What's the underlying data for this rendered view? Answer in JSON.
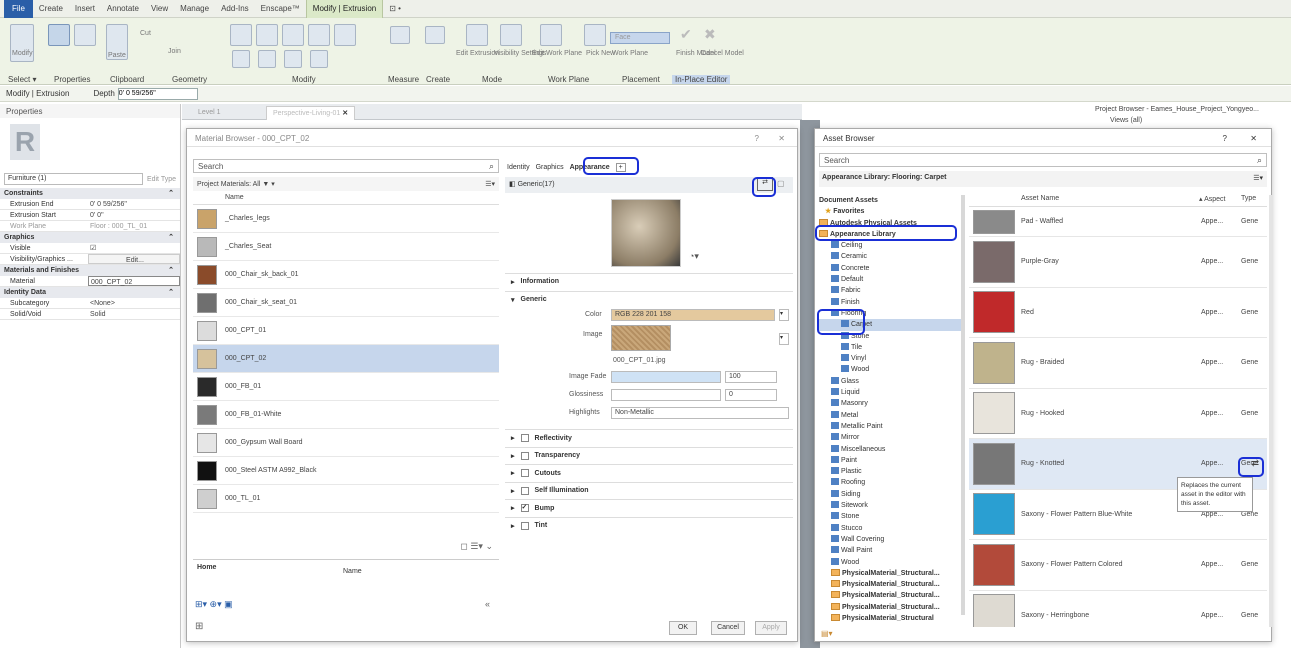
{
  "menu": [
    "File",
    "Create",
    "Insert",
    "Annotate",
    "View",
    "Manage",
    "Add-Ins",
    "Enscape™",
    "Modify | Extrusion",
    "⊡ •"
  ],
  "ribbon": {
    "groups": [
      "Select ▾",
      "Properties",
      "Clipboard",
      "Geometry",
      "Modify",
      "Measure",
      "Create",
      "Mode",
      "Work Plane",
      "Placement",
      "In-Place Editor"
    ],
    "small": {
      "modify": "Modify",
      "paste": "Paste",
      "cut": "Cut",
      "join": "Join",
      "edit_extrusion": "Edit Extrusion",
      "visibility": "Visibility Settings",
      "edit_wp": "Edit Work Plane",
      "pick_new": "Pick New",
      "face": "Face",
      "work_plane": "Work Plane",
      "finish_model": "Finish Model",
      "cancel_model": "Cancel Model"
    }
  },
  "options": {
    "context": "Modify | Extrusion",
    "depth_label": "Depth",
    "depth_value": "0' 0 59/256\""
  },
  "properties": {
    "title": "Properties",
    "type_selector": "Furniture (1)",
    "edit_type": "Edit Type",
    "groups": [
      {
        "name": "Constraints",
        "rows": [
          [
            "Extrusion End",
            "0' 0 59/256\""
          ],
          [
            "Extrusion Start",
            "0' 0\""
          ],
          [
            "Work Plane",
            "Floor : 000_TL_01"
          ]
        ]
      },
      {
        "name": "Graphics",
        "rows": [
          [
            "Visible",
            "☑"
          ],
          [
            "Visibility/Graphics ...",
            "Edit..."
          ]
        ]
      },
      {
        "name": "Materials and Finishes",
        "rows": [
          [
            "Material",
            "000_CPT_02"
          ]
        ]
      },
      {
        "name": "Identity Data",
        "rows": [
          [
            "Subcategory",
            "<None>"
          ],
          [
            "Solid/Void",
            "Solid"
          ]
        ]
      }
    ]
  },
  "tabs": [
    "Level 1",
    "Perspective-Living-01"
  ],
  "project_browser": "Project Browser - Eames_House_Project_Yongyeo...",
  "views_all": "Views (all)",
  "material_browser": {
    "title": "Material Browser - 000_CPT_02",
    "help": "?",
    "close": "✕",
    "search": "Search",
    "filter": "Project Materials: All ▼ ▾",
    "col_name": "Name",
    "materials": [
      "_Charles_legs",
      "_Charles_Seat",
      "000_Chair_sk_back_01",
      "000_Chair_sk_seat_01",
      "000_CPT_01",
      "000_CPT_02",
      "000_FB_01",
      "000_FB_01-White",
      "000_Gypsum Wall Board",
      "000_Steel ASTM A992_Black",
      "000_TL_01"
    ],
    "home": "Home",
    "name_col": "Name",
    "tabs": [
      "Identity",
      "Graphics",
      "Appearance"
    ],
    "asset_name": "Generic(17)",
    "sections": {
      "information": "Information",
      "generic": "Generic"
    },
    "color_label": "Color",
    "color_value": "RGB 228 201 158",
    "image_label": "Image",
    "image_file": "000_CPT_01.jpg",
    "image_fade_label": "Image Fade",
    "image_fade_value": "100",
    "glossiness_label": "Glossiness",
    "glossiness_value": "0",
    "highlights_label": "Highlights",
    "highlights_value": "Non-Metallic",
    "collapsed": [
      "Reflectivity",
      "Transparency",
      "Cutouts",
      "Self Illumination",
      "Bump",
      "Tint"
    ],
    "ok": "OK",
    "cancel": "Cancel",
    "apply": "Apply"
  },
  "asset_browser": {
    "title": "Asset Browser",
    "help": "?",
    "close": "✕",
    "search": "Search",
    "breadcrumb": "Appearance Library: Flooring: Carpet",
    "tree": [
      "Document Assets",
      "Favorites",
      "Autodesk Physical Assets",
      "Appearance Library",
      "Ceiling",
      "Ceramic",
      "Concrete",
      "Default",
      "Fabric",
      "Finish",
      "Flooring",
      "Carpet",
      "Stone",
      "Tile",
      "Vinyl",
      "Wood",
      "Glass",
      "Liquid",
      "Masonry",
      "Metal",
      "Metallic Paint",
      "Mirror",
      "Miscellaneous",
      "Paint",
      "Plastic",
      "Roofing",
      "Siding",
      "Sitework",
      "Stone",
      "Stucco",
      "Wall Covering",
      "Wall Paint",
      "Wood",
      "PhysicalMaterial_Structural...",
      "PhysicalMaterial_Structural...",
      "PhysicalMaterial_Structural...",
      "PhysicalMaterial_Structural...",
      "PhysicalMaterial_Structural"
    ],
    "cols": {
      "name": "Asset Name",
      "aspect": "Aspect",
      "type": "Type"
    },
    "assets": [
      [
        "Pad - Waffled",
        "Appe...",
        "Gene"
      ],
      [
        "Purple-Gray",
        "Appe...",
        "Gene"
      ],
      [
        "Red",
        "Appe...",
        "Gene"
      ],
      [
        "Rug - Braided",
        "Appe...",
        "Gene"
      ],
      [
        "Rug - Hooked",
        "Appe...",
        "Gene"
      ],
      [
        "Rug - Knotted",
        "Appe...",
        "Gene"
      ],
      [
        "Saxony - Flower Pattern Blue-White",
        "Appe...",
        "Gene"
      ],
      [
        "Saxony - Flower Pattern Colored",
        "Appe...",
        "Gene"
      ],
      [
        "Saxony - Herringbone",
        "Appe...",
        "Gene"
      ]
    ],
    "tooltip": "Replaces the current asset in the editor with this asset."
  },
  "colors": {
    "accent": "#1a2fd6",
    "selection": "#c6d6ec",
    "ribbon": "#eef3e6"
  }
}
